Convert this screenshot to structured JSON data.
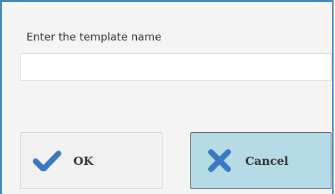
{
  "dialog": {
    "prompt": "Enter the template name",
    "name_input": {
      "value": "",
      "placeholder": ""
    },
    "ok_button": {
      "label": "OK",
      "icon": "checkmark-icon"
    },
    "cancel_button": {
      "label": "Cancel",
      "icon": "x-icon"
    }
  },
  "colors": {
    "border": "#3f88c4",
    "dialog_background": "#f4f4f4",
    "icon_blue": "#3a78c2",
    "cancel_background": "#b4dbe6",
    "ok_background": "#f2f2f2"
  }
}
